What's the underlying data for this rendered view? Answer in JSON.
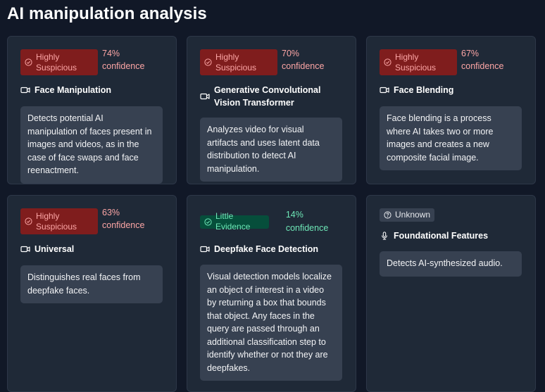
{
  "page": {
    "title": "AI manipulation analysis"
  },
  "colors": {
    "background": "#111827",
    "card": "#1f2937",
    "description_box": "#374151",
    "danger_badge_bg": "#7f1d1d",
    "danger_text": "#fca5a5",
    "success_badge_bg": "#064e3b",
    "success_text": "#6ee7b7",
    "neutral_badge_bg": "#374151"
  },
  "cards": [
    {
      "status": "danger",
      "status_icon": "check-circle-icon",
      "badge_line1": "Highly",
      "badge_line2": "Suspicious",
      "confidence_line1": "74%",
      "confidence_line2": "confidence",
      "model_icon": "video-camera-icon",
      "model_name": "Face Manipulation",
      "description": "Detects potential AI manipulation of faces present in images and videos, as in the case of face swaps and face reenactment."
    },
    {
      "status": "danger",
      "status_icon": "check-circle-icon",
      "badge_line1": "Highly",
      "badge_line2": "Suspicious",
      "confidence_line1": "70%",
      "confidence_line2": "confidence",
      "model_icon": "video-camera-icon",
      "model_name": "Generative Convolutional Vision Transformer",
      "description": "Analyzes video for visual artifacts and uses latent data distribution to detect AI manipulation."
    },
    {
      "status": "danger",
      "status_icon": "check-circle-icon",
      "badge_line1": "Highly",
      "badge_line2": "Suspicious",
      "confidence_line1": "67%",
      "confidence_line2": "confidence",
      "model_icon": "video-camera-icon",
      "model_name": "Face Blending",
      "description": "Face blending is a process where AI takes two or more images and creates a new composite facial image."
    },
    {
      "status": "danger",
      "status_icon": "check-circle-icon",
      "badge_line1": "Highly",
      "badge_line2": "Suspicious",
      "confidence_line1": "63%",
      "confidence_line2": "confidence",
      "model_icon": "video-camera-icon",
      "model_name": "Universal",
      "description": "Distinguishes real faces from deepfake faces."
    },
    {
      "status": "success",
      "status_icon": "check-circle-icon",
      "badge_label": "Little Evidence",
      "confidence": "14% confidence",
      "model_icon": "video-camera-icon",
      "model_name": "Deepfake Face Detection",
      "description": "Visual detection models localize an object of interest in a video by returning a box that bounds that object. Any faces in the query are passed through an additional classification step to identify whether or not they are deepfakes."
    },
    {
      "status": "neutral",
      "status_icon": "question-circle-icon",
      "badge_label": "Unknown",
      "model_icon": "microphone-icon",
      "model_name": "Foundational Features",
      "description": "Detects AI-synthesized audio."
    }
  ]
}
